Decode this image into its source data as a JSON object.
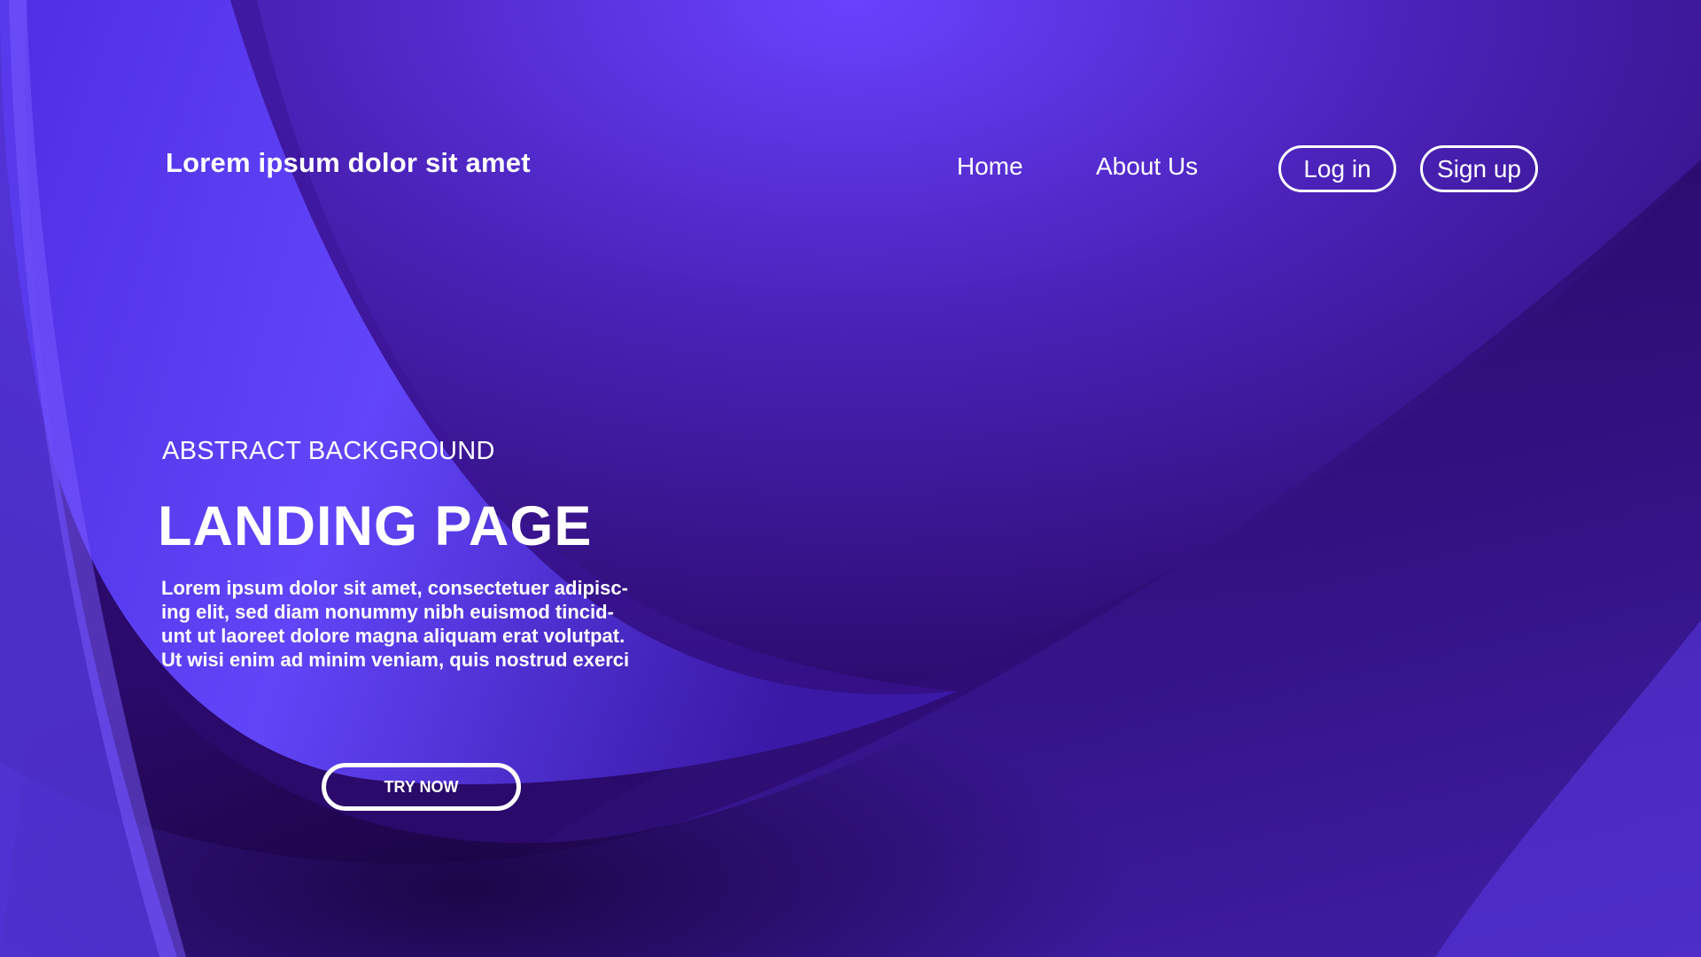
{
  "colors": {
    "background_dark": "#1e0650",
    "background_mid": "#4a22b8",
    "highlight": "#6a45ff",
    "text": "#ffffff"
  },
  "header": {
    "brand": "Lorem ipsum dolor sit amet",
    "nav": [
      {
        "label": "Home"
      },
      {
        "label": "About Us"
      }
    ],
    "login_label": "Log in",
    "signup_label": "Sign up"
  },
  "hero": {
    "eyebrow": "ABSTRACT BACKGROUND",
    "title": "LANDING PAGE",
    "body_lines": [
      "Lorem ipsum dolor sit amet, consectetuer adipisc-",
      "ing elit, sed diam nonummy nibh euismod tincid-",
      "unt ut laoreet dolore magna aliquam erat volutpat.",
      "Ut wisi enim ad minim veniam, quis nostrud exerci"
    ],
    "cta_label": "TRY NOW"
  }
}
